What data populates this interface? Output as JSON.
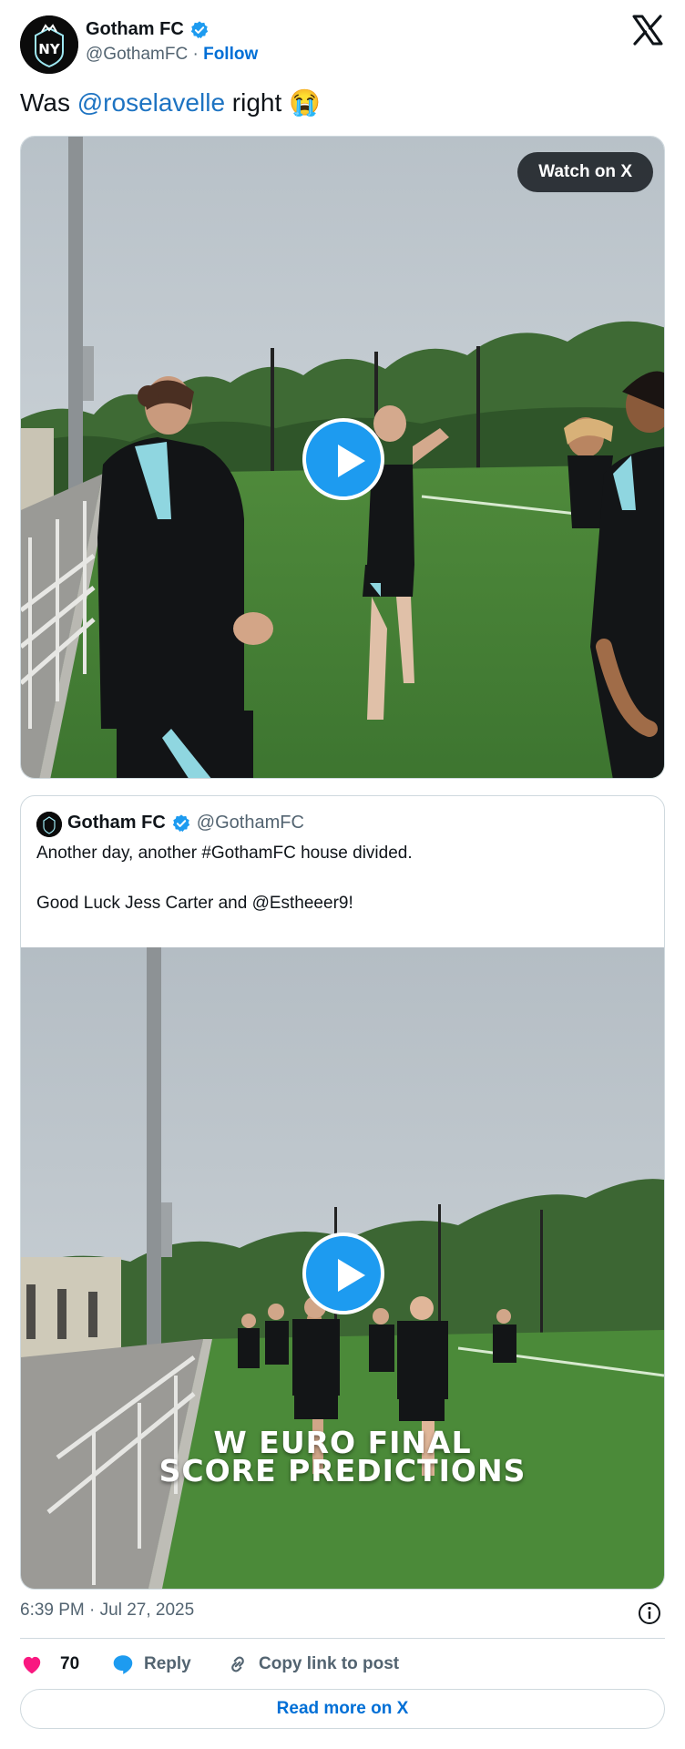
{
  "author": {
    "name": "Gotham FC",
    "handle": "@GothamFC",
    "separator": "·",
    "follow_label": "Follow",
    "avatar_text": "NY"
  },
  "tweet": {
    "text_before": "Was ",
    "mention": "@roselavelle",
    "text_after": " right",
    "emoji": "😭"
  },
  "media": {
    "watch_label": "Watch on X"
  },
  "quote": {
    "name": "Gotham FC",
    "handle": "@GothamFC",
    "line1": "Another day, another #GothamFC house divided.",
    "line2": "Good Luck Jess Carter and @Estheeer9!",
    "overlay_line1": "W EURO FINAL",
    "overlay_line2": "SCORE PREDICTIONS"
  },
  "footer": {
    "timestamp": "6:39 PM · Jul 27, 2025",
    "like_count": "70",
    "reply_label": "Reply",
    "copy_label": "Copy link to post",
    "read_more_label": "Read more on X"
  },
  "colors": {
    "accent": "#1d9bf0",
    "link": "#006fd6",
    "like": "#f91880",
    "muted": "#536471"
  }
}
